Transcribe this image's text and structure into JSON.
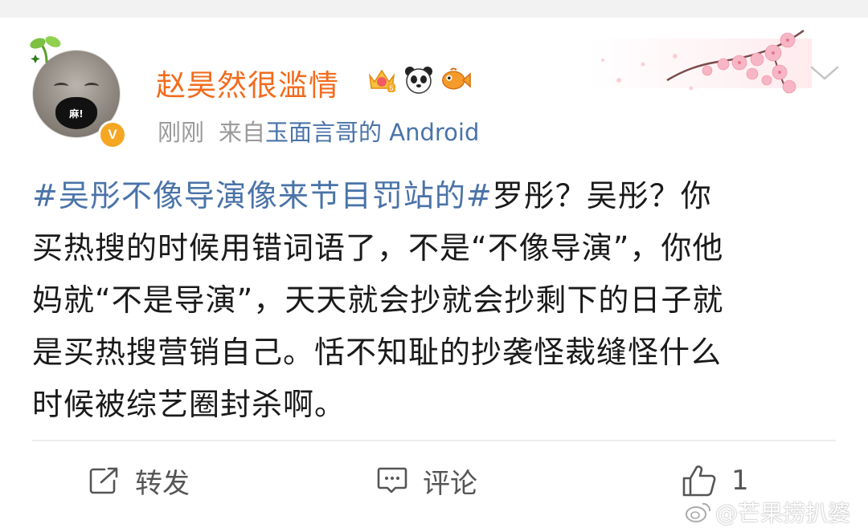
{
  "post": {
    "author": {
      "name": "赵昊然很滥情",
      "avatar_text": "麻!",
      "verified_mark": "V"
    },
    "time": "刚刚",
    "source_prefix": "来自",
    "source_link": "玉面言哥的",
    "source_suffix": " Android",
    "badges": [
      "crown-badge-icon",
      "panda-icon",
      "fish-icon"
    ],
    "text_lines": [
      {
        "hashtag": "#吴彤不像导演像来节目罚站的#",
        "text": "罗彤？吴彤？你"
      },
      {
        "hashtag": "",
        "text": "买热搜的时候用错词语了，不是“不像导演”，你他"
      },
      {
        "hashtag": "",
        "text": "妈就“不是导演”，天天就会抄就会抄剩下的日子就"
      },
      {
        "hashtag": "",
        "text": "是买热搜营销自己。恬不知耻的抄袭怪裁缝怪什么"
      },
      {
        "hashtag": "",
        "text": "时候被综艺圈封杀啊。"
      }
    ]
  },
  "actions": {
    "repost_label": "转发",
    "comment_label": "评论",
    "like_count": "1"
  },
  "watermark": "@芒果捞扒婆",
  "colors": {
    "username": "#f26b1d",
    "link": "#4a73a8",
    "meta": "#9a9a9a",
    "badge": "#f5a623"
  }
}
